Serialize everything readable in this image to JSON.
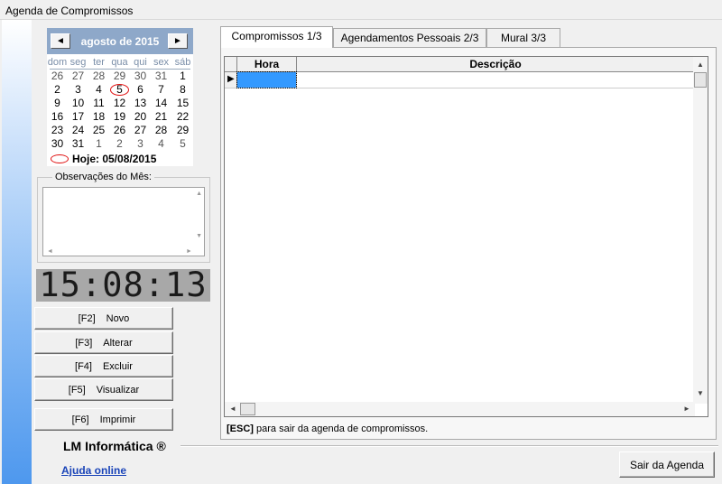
{
  "window": {
    "title": "Agenda de Compromissos"
  },
  "calendar": {
    "month_label": "agosto de 2015",
    "prev_icon": "◄",
    "next_icon": "►",
    "weekdays": [
      "dom",
      "seg",
      "ter",
      "qua",
      "qui",
      "sex",
      "sáb"
    ],
    "weeks": [
      [
        "26",
        "27",
        "28",
        "29",
        "30",
        "31",
        "1"
      ],
      [
        "2",
        "3",
        "4",
        "5",
        "6",
        "7",
        "8"
      ],
      [
        "9",
        "10",
        "11",
        "12",
        "13",
        "14",
        "15"
      ],
      [
        "16",
        "17",
        "18",
        "19",
        "20",
        "21",
        "22"
      ],
      [
        "23",
        "24",
        "25",
        "26",
        "27",
        "28",
        "29"
      ],
      [
        "30",
        "31",
        "1",
        "2",
        "3",
        "4",
        "5"
      ]
    ],
    "today_label": "Hoje: 05/08/2015",
    "today_color": "#e01010"
  },
  "obs": {
    "legend": "Observações do Mês:",
    "text": ""
  },
  "clock": {
    "time": "15:08:13"
  },
  "actions": [
    {
      "key": "[F2]",
      "label": "Novo"
    },
    {
      "key": "[F3]",
      "label": "Alterar"
    },
    {
      "key": "[F4]",
      "label": "Excluir"
    },
    {
      "key": "[F5]",
      "label": "Visualizar"
    },
    {
      "key": "[F6]",
      "label": "Imprimir"
    }
  ],
  "brand": {
    "name": "LM Informática ®",
    "help_link": "Ajuda online"
  },
  "tabs": [
    {
      "label": "Compromissos 1/3",
      "active": true
    },
    {
      "label": "Agendamentos Pessoais 2/3",
      "active": false
    },
    {
      "label": "Mural 3/3",
      "active": false
    }
  ],
  "grid": {
    "columns": [
      "Hora",
      "Descrição"
    ],
    "row_indicator": "▶",
    "selection_color": "#3399ff"
  },
  "footer": {
    "esc_key": "[ESC]",
    "esc_text": " para sair da agenda de compromissos."
  },
  "exit_button": {
    "label": "Sair da Agenda"
  }
}
